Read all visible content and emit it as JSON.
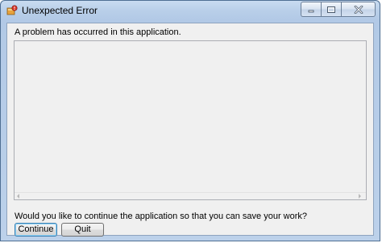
{
  "window": {
    "title": "Unexpected Error",
    "icon": "application-error-icon",
    "caption_buttons": [
      "minimize-icon",
      "maximize-icon",
      "close-icon"
    ]
  },
  "dialog": {
    "message": "A problem has occurred in this application.",
    "details_text": "",
    "question": "Would you like to continue the application so that you can save your work?",
    "continue_label": "Continue",
    "quit_label": "Quit"
  },
  "colors": {
    "titlebar": "#b9cfe9",
    "client_background": "#f0f0f0",
    "default_button_border": "#3c7fb1"
  }
}
